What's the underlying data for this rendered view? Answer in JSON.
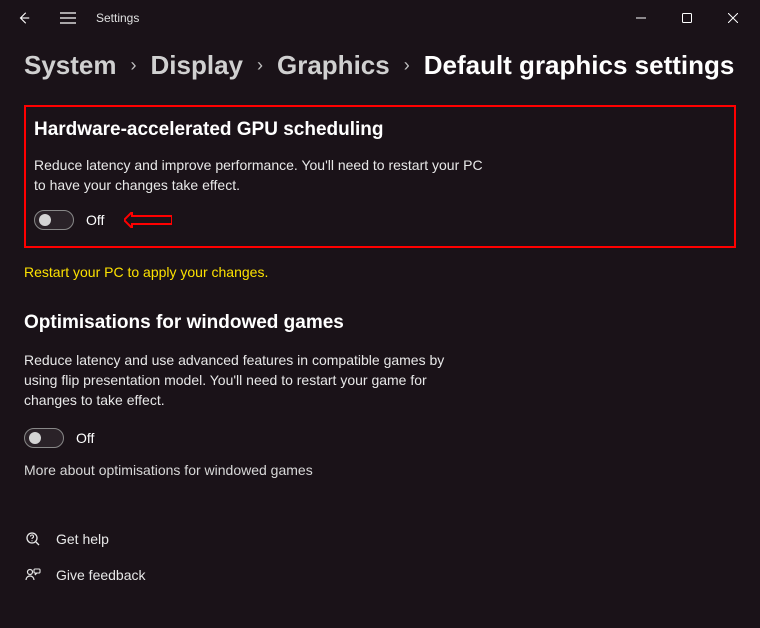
{
  "window": {
    "title": "Settings"
  },
  "breadcrumb": {
    "items": [
      "System",
      "Display",
      "Graphics",
      "Default graphics settings"
    ]
  },
  "section1": {
    "title": "Hardware-accelerated GPU scheduling",
    "description": "Reduce latency and improve performance. You'll need to restart your PC to have your changes take effect.",
    "toggle_state": "Off"
  },
  "restart_note": "Restart your PC to apply your changes.",
  "section2": {
    "title": "Optimisations for windowed games",
    "description": "Reduce latency and use advanced features in compatible games by using flip presentation model. You'll need to restart your game for changes to take effect.",
    "toggle_state": "Off",
    "more_link": "More about optimisations for windowed games"
  },
  "footer": {
    "help": "Get help",
    "feedback": "Give feedback"
  }
}
